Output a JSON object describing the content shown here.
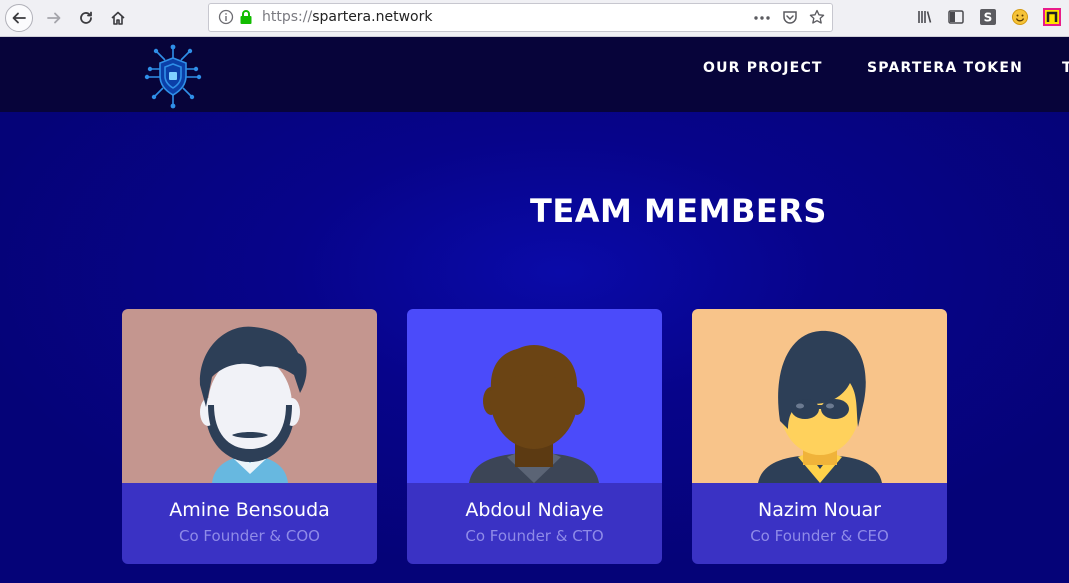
{
  "browser": {
    "url_protocol": "https://",
    "url_host": "spartera.network"
  },
  "site": {
    "menu": [
      {
        "label": "OUR PROJECT"
      },
      {
        "label": "SPARTERA TOKEN"
      },
      {
        "label": "T"
      }
    ]
  },
  "team": {
    "title": "TEAM MEMBERS",
    "members": [
      {
        "name": "Amine Bensouda",
        "role": "Co Founder & COO",
        "bg": "#c4968f"
      },
      {
        "name": "Abdoul Ndiaye",
        "role": "Co Founder & CTO",
        "bg": "#4b4bfa"
      },
      {
        "name": "Nazim Nouar",
        "role": "Co Founder & CEO",
        "bg": "#f8c48a"
      }
    ]
  }
}
